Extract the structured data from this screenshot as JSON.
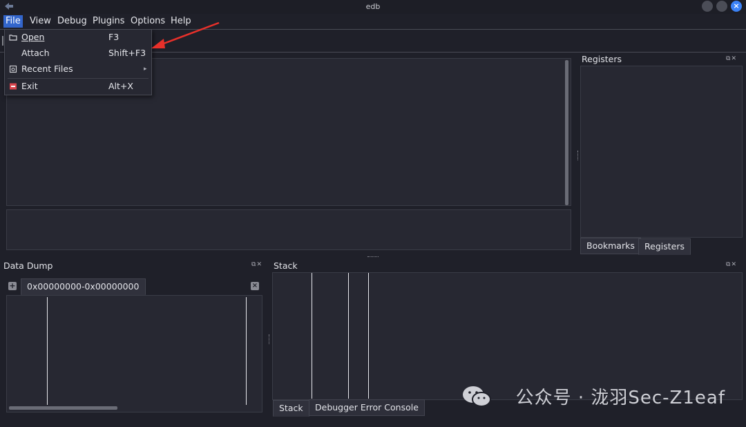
{
  "window": {
    "title": "edb"
  },
  "menu": [
    "File",
    "View",
    "Debug",
    "Plugins",
    "Options",
    "Help"
  ],
  "file_menu": {
    "items": [
      {
        "label": "Open",
        "shortcut": "F3",
        "icon": "folder-open-icon"
      },
      {
        "label": "Attach",
        "shortcut": "Shift+F3",
        "icon": ""
      },
      {
        "label": "Recent Files",
        "shortcut": "",
        "icon": "recent-files-icon",
        "submenu": true
      },
      {
        "label": "Exit",
        "shortcut": "Alt+X",
        "icon": "exit-icon"
      }
    ]
  },
  "panels": {
    "registers": {
      "title": "Registers",
      "tabs": [
        "Bookmarks",
        "Registers"
      ],
      "selected_tab": "Registers"
    },
    "data_dump": {
      "title": "Data Dump",
      "tab_label": "0x00000000-0x00000000"
    },
    "stack": {
      "title": "Stack",
      "tabs": [
        "Stack",
        "Debugger Error Console"
      ],
      "selected_tab": "Stack"
    }
  },
  "watermark": {
    "text": "公众号 · 泷羽Sec-Z1eaf"
  },
  "colors": {
    "accent": "#3366cc",
    "annotation_arrow": "#e8302a",
    "close_button": "#3b82f6"
  }
}
